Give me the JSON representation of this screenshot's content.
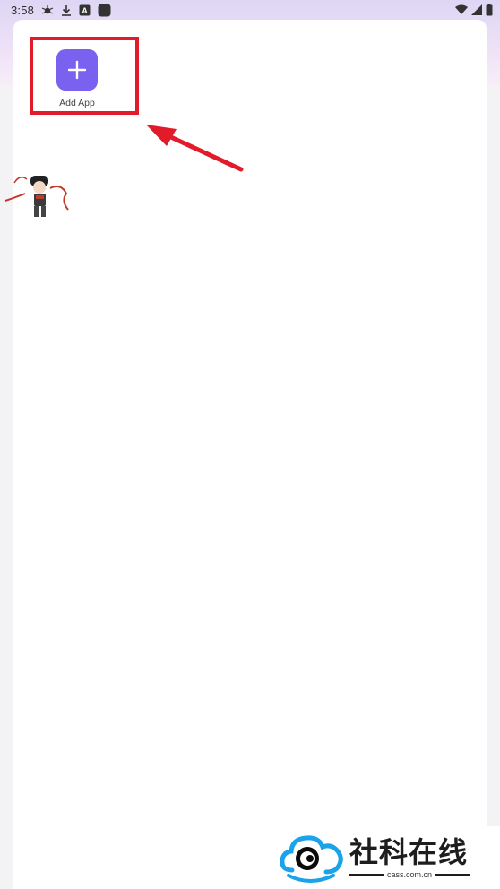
{
  "status_bar": {
    "time": "3:58"
  },
  "launcher": {
    "add_app_label": "Add App"
  },
  "watermark": {
    "title": "社科在线",
    "url": "cass.com.cn"
  },
  "colors": {
    "accent": "#7b61f0",
    "highlight": "#e21b2a",
    "panel": "#ffffff",
    "watermark_blue": "#1aa3e8"
  },
  "icons": [
    "bug-icon",
    "download-icon",
    "android-icon",
    "app-icon",
    "wifi-icon",
    "signal-icon",
    "battery-icon",
    "plus-icon",
    "cloud-eye-logo"
  ]
}
